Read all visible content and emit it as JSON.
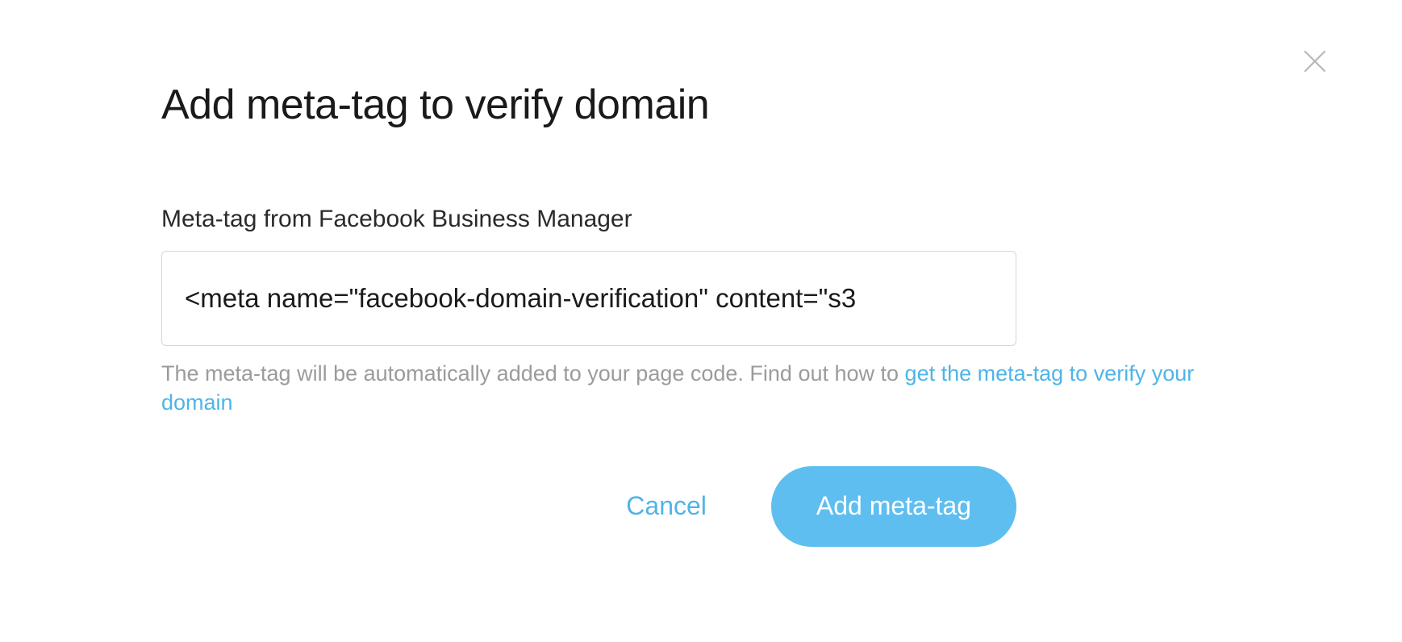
{
  "dialog": {
    "title": "Add meta-tag to verify domain",
    "field_label": "Meta-tag from Facebook Business Manager",
    "input_value": "<meta name=\"facebook-domain-verification\" content=\"s3",
    "helper_text_1": "The meta-tag will be automatically added to your page code. Find out how to ",
    "helper_link": "get the meta-tag to verify your domain",
    "cancel_label": "Cancel",
    "submit_label": "Add meta-tag"
  }
}
